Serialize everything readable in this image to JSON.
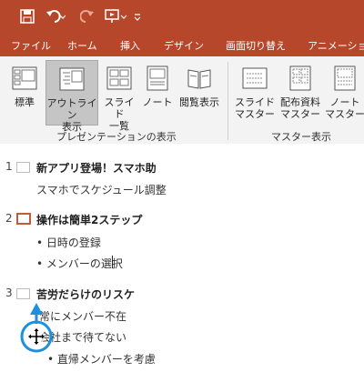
{
  "ribbon_tabs": [
    {
      "label": "ファイル"
    },
    {
      "label": "ホーム"
    },
    {
      "label": "挿入"
    },
    {
      "label": "デザイン"
    },
    {
      "label": "画面切り替え"
    },
    {
      "label": "アニメーショ"
    }
  ],
  "presentation_views": {
    "normal": "標準",
    "outline": "アウトライン\n表示",
    "slide_sorter": "スライド\n一覧",
    "notes": "ノート",
    "reading": "閲覧表示",
    "group_label": "プレゼンテーションの表示"
  },
  "master_views": {
    "slide_master": "スライド\nマスター",
    "handout_master": "配布資料\nマスター",
    "notes_master": "ノート\nマスター",
    "group_label": "マスター表示"
  },
  "slides": [
    {
      "number": "1",
      "title": "新アプリ登場！スマホ助",
      "lines": [
        "スマホでスケジュール調整"
      ]
    },
    {
      "number": "2",
      "title": "操作は簡単2ステップ",
      "lines": [
        "• 日時の登録",
        "• メンバーの選択"
      ]
    },
    {
      "number": "3",
      "title": "苦労だらけのリスケ",
      "lines": [
        "常にメンバー不在",
        "会社まで待てない",
        "• 直帰メンバーを考慮"
      ]
    }
  ],
  "colors": {
    "accent": "#b7472a",
    "cursor": "#1e90e0"
  }
}
